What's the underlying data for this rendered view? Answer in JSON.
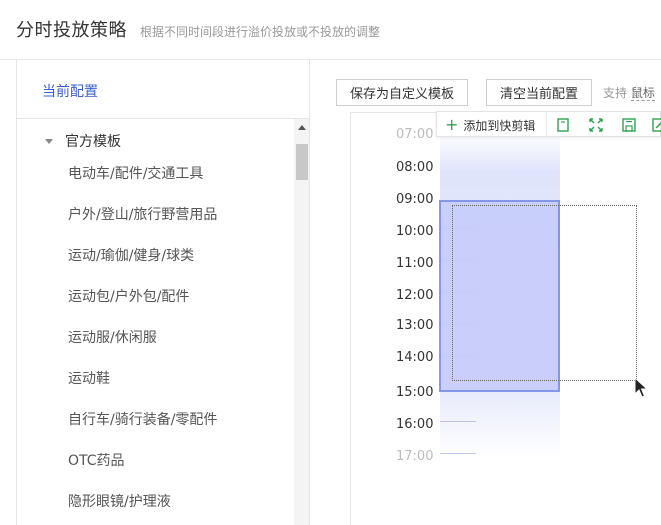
{
  "header": {
    "title": "分时投放策略",
    "subtitle": "根据不同时间段进行溢价投放或不投放的调整"
  },
  "left_panel": {
    "current_config": "当前配置",
    "group_label": "官方模板",
    "items": [
      "电动车/配件/交通工具",
      "户外/登山/旅行野营用品",
      "运动/瑜伽/健身/球类",
      "运动包/户外包/配件",
      "运动服/休闲服",
      "运动鞋",
      "自行车/骑行装备/零配件",
      "OTC药品",
      "隐形眼镜/护理液"
    ]
  },
  "toolbar": {
    "save_template": "保存为自定义模板",
    "clear_config": "清空当前配置",
    "support_prefix": "支持",
    "support_link": "鼠标"
  },
  "float_toolbar": {
    "add_clip": "添加到快剪辑",
    "icons": [
      "copy-icon",
      "fullscreen-icon",
      "save-icon",
      "edit-icon"
    ]
  },
  "schedule": {
    "hours": [
      "07:00",
      "08:00",
      "09:00",
      "10:00",
      "11:00",
      "12:00",
      "13:00",
      "14:00",
      "15:00",
      "16:00",
      "17:00"
    ],
    "selected_range": [
      "09:00",
      "15:00"
    ]
  },
  "colors": {
    "accent": "#3a5fcd",
    "selection_fill": "#c6cdfa",
    "selection_border": "#7b8ee8",
    "add_icon": "#2ea44f",
    "toolbar_icon": "#2ea44f"
  }
}
